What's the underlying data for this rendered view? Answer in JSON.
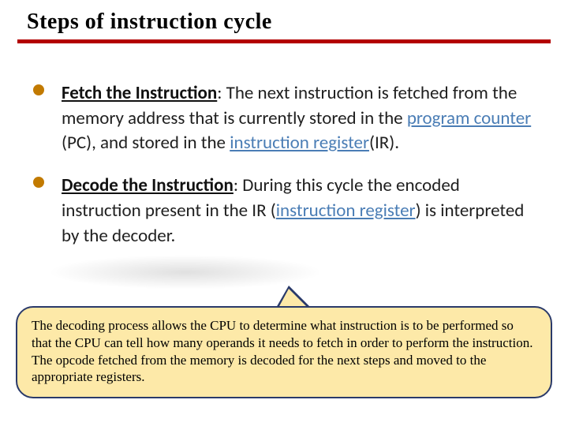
{
  "title": "Steps of instruction cycle",
  "bullets": [
    {
      "head": "Fetch the Instruction",
      "pre": ": The next instruction is fetched from the memory address that is currently stored in the ",
      "link1": "program counter",
      "mid": " (PC), and stored in the ",
      "link2": "instruction register",
      "post": "(IR)."
    },
    {
      "head": "Decode the Instruction",
      "pre": ": During this cycle the encoded instruction present in the IR (",
      "link1": "instruction register",
      "mid": ") is interpreted by the decoder.",
      "link2": "",
      "post": ""
    }
  ],
  "callout": "The decoding process allows the CPU to determine what instruction is to be performed so that the CPU can tell how many operands it needs to fetch in order to perform the instruction. The opcode fetched from the memory is decoded for the next steps and moved to the appropriate registers."
}
